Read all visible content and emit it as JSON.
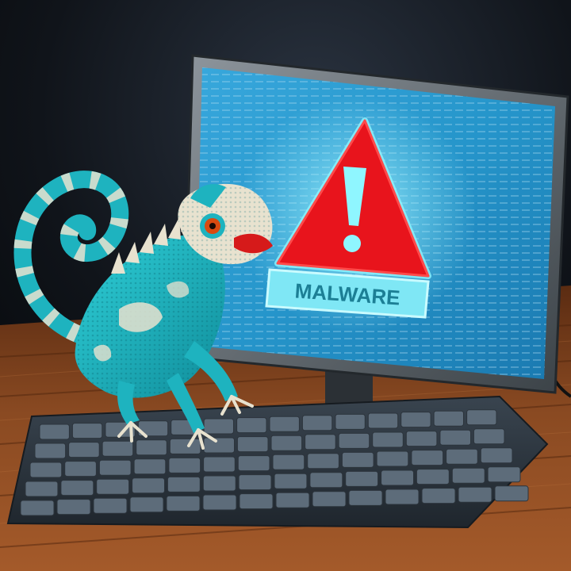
{
  "warning_banner": {
    "text": "MALWARE"
  },
  "icons": {
    "warning": "warning-triangle-icon",
    "lizard": "chameleon-illustration"
  },
  "colors": {
    "screen_blue": "#2a9fd6",
    "warning_red": "#e8141c",
    "chameleon_teal": "#1eb3bf",
    "wood": "#8a4a22",
    "keyboard": "#4a5866"
  }
}
